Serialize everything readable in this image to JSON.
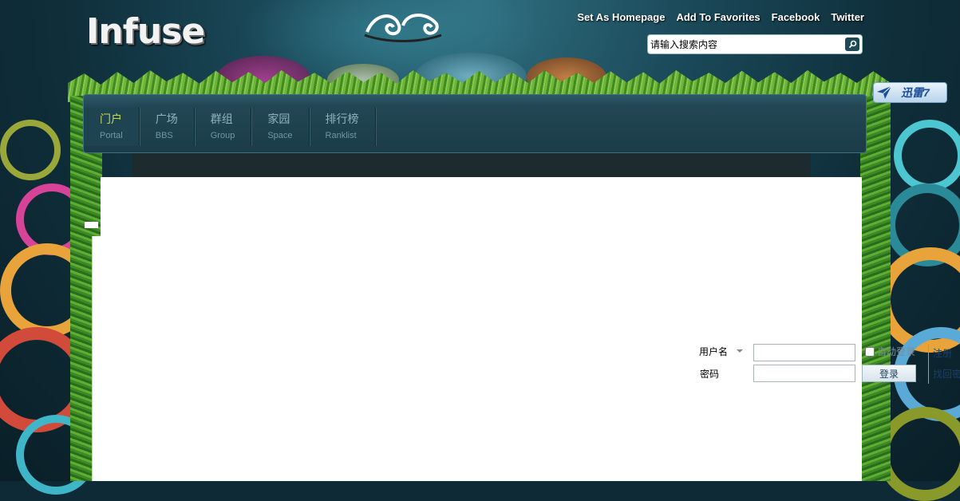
{
  "header": {
    "logo_text": "Infuse",
    "links": [
      {
        "label": "Set As Homepage"
      },
      {
        "label": "Add To Favorites"
      },
      {
        "label": "Facebook"
      },
      {
        "label": "Twitter"
      }
    ],
    "search": {
      "placeholder": "请输入搜索内容",
      "icon": "search-icon"
    },
    "badge_label": "迅雷7"
  },
  "nav": {
    "items": [
      {
        "cn": "门户",
        "en": "Portal",
        "active": true
      },
      {
        "cn": "广场",
        "en": "BBS",
        "active": false
      },
      {
        "cn": "群组",
        "en": "Group",
        "active": false
      },
      {
        "cn": "家园",
        "en": "Space",
        "active": false
      },
      {
        "cn": "排行榜",
        "en": "Ranklist",
        "active": false
      }
    ]
  },
  "login": {
    "username_label": "用户名",
    "password_label": "密码",
    "remember_label": "自动登录",
    "submit_label": "登录",
    "register_label": "注册",
    "forgot_label": "找回密码"
  },
  "colors": {
    "nav_active_text": "#c9d84a",
    "nav_text": "#8fb4c0",
    "page_background": "#0d2a36"
  }
}
